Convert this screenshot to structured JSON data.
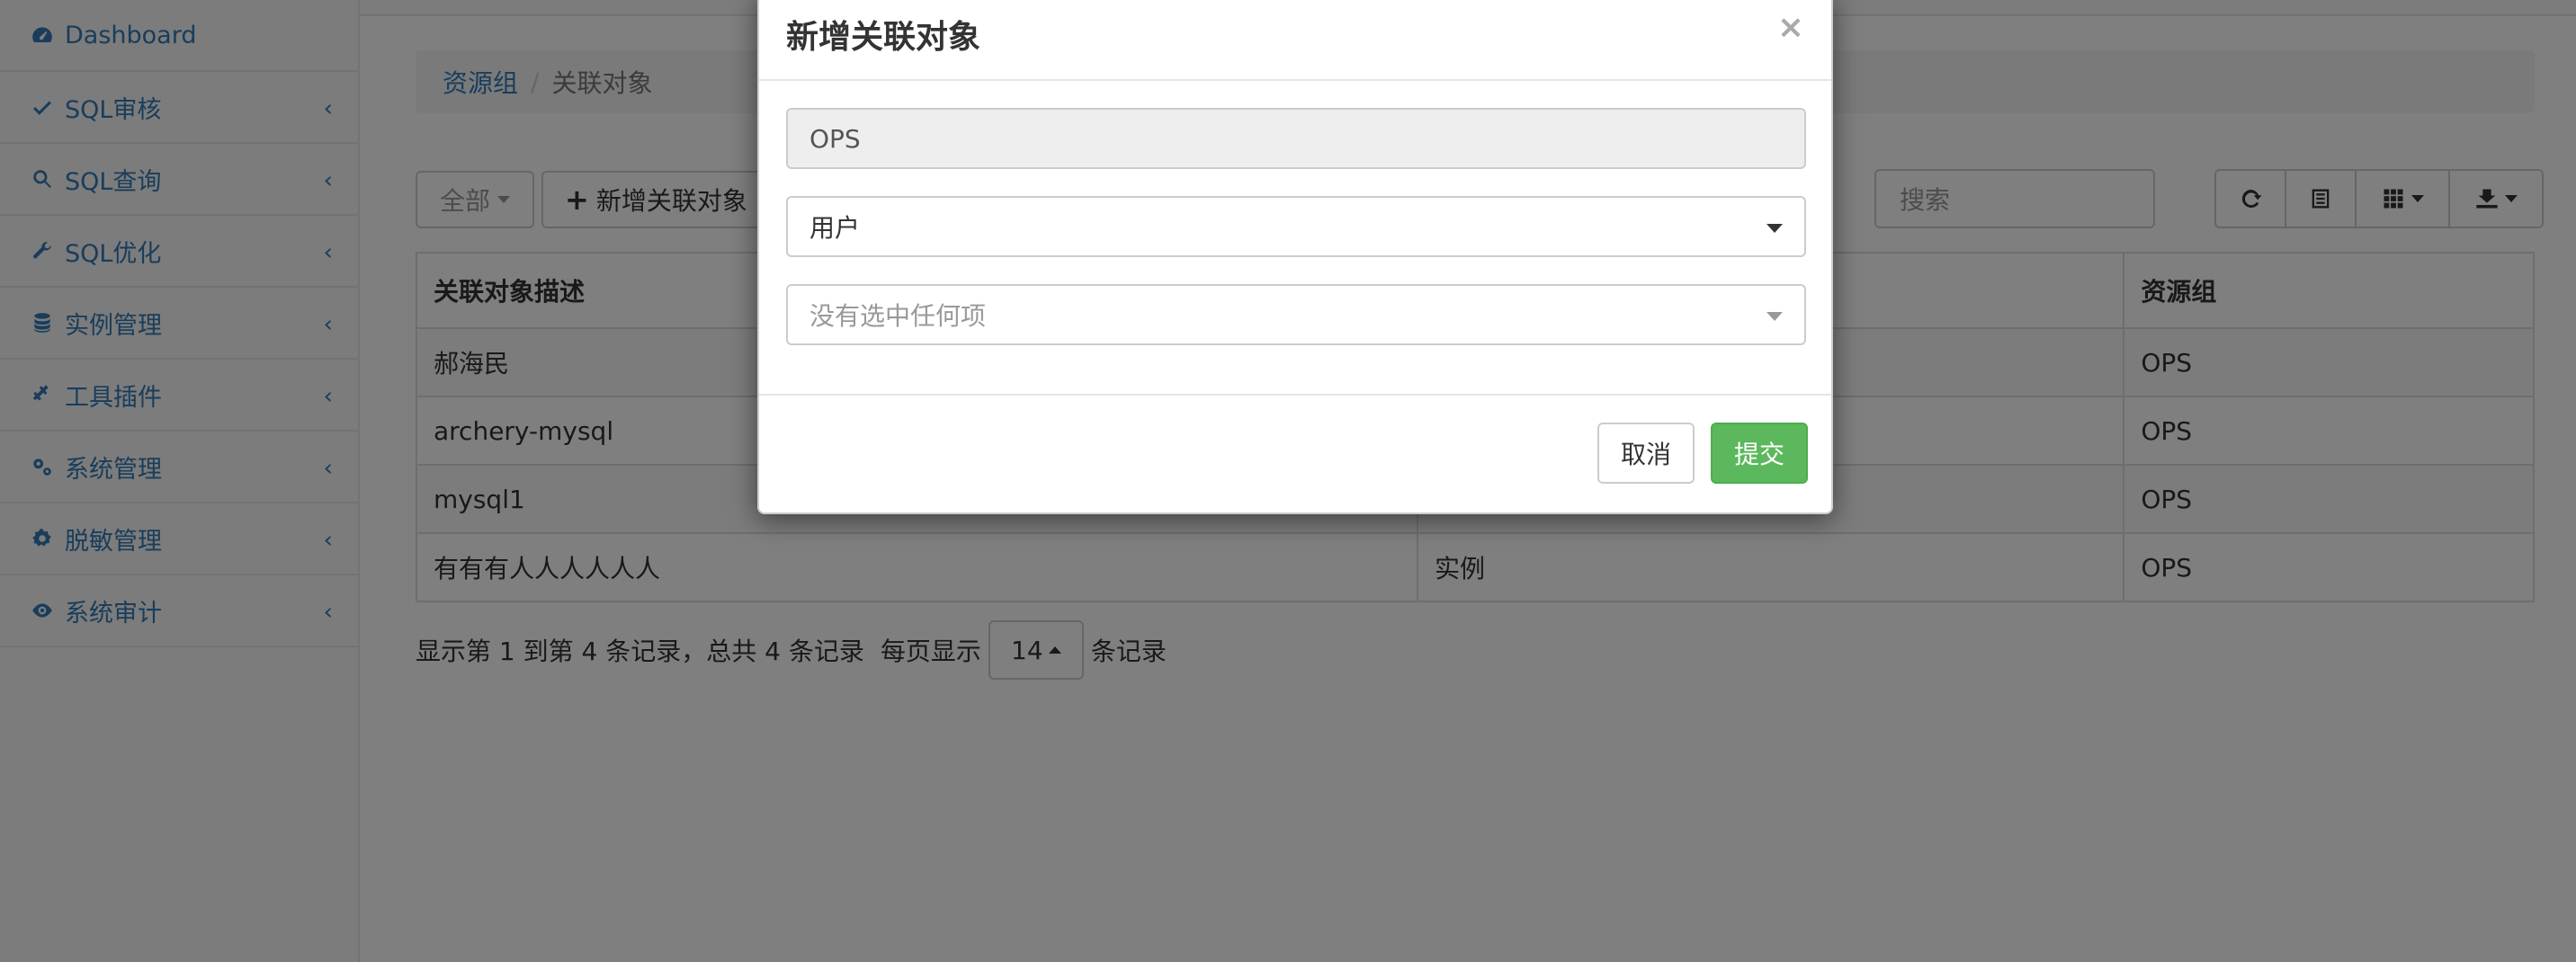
{
  "sidebar": {
    "items": [
      {
        "label": "Dashboard",
        "icon": "dashboard-icon",
        "has_chevron": false
      },
      {
        "label": "SQL审核",
        "icon": "check-icon",
        "has_chevron": true
      },
      {
        "label": "SQL查询",
        "icon": "search-icon",
        "has_chevron": true
      },
      {
        "label": "SQL优化",
        "icon": "wrench-icon",
        "has_chevron": true
      },
      {
        "label": "实例管理",
        "icon": "database-icon",
        "has_chevron": true
      },
      {
        "label": "工具插件",
        "icon": "plug-icon",
        "has_chevron": true
      },
      {
        "label": "系统管理",
        "icon": "gears-icon",
        "has_chevron": true
      },
      {
        "label": "脱敏管理",
        "icon": "gear-icon",
        "has_chevron": true
      },
      {
        "label": "系统审计",
        "icon": "eye-icon",
        "has_chevron": true
      }
    ],
    "chevron": "‹"
  },
  "breadcrumb": {
    "parent": "资源组",
    "separator": "/",
    "current": "关联对象"
  },
  "toolbar": {
    "filter_label": "全部",
    "add_label": "新增关联对象",
    "search_placeholder": "搜索"
  },
  "table": {
    "headers": [
      "关联对象描述",
      "",
      "资源组"
    ],
    "rows": [
      [
        "郝海民",
        "",
        "OPS"
      ],
      [
        "archery-mysql",
        "",
        "OPS"
      ],
      [
        "mysql1",
        "",
        "OPS"
      ],
      [
        "有有有人人人人人人",
        "实例",
        "OPS"
      ]
    ]
  },
  "pager": {
    "summary": "显示第 1 到第 4 条记录，总共 4 条记录",
    "per_page_prefix": "每页显示",
    "page_size": "14",
    "per_page_suffix": "条记录"
  },
  "modal": {
    "title": "新增关联对象",
    "close": "×",
    "group_value": "OPS",
    "type_value": "用户",
    "object_placeholder": "没有选中任何项",
    "cancel_label": "取消",
    "submit_label": "提交"
  },
  "colors": {
    "link": "#337ab7",
    "success": "#5cb85c",
    "overlay": "rgba(0,0,0,0.5)"
  }
}
